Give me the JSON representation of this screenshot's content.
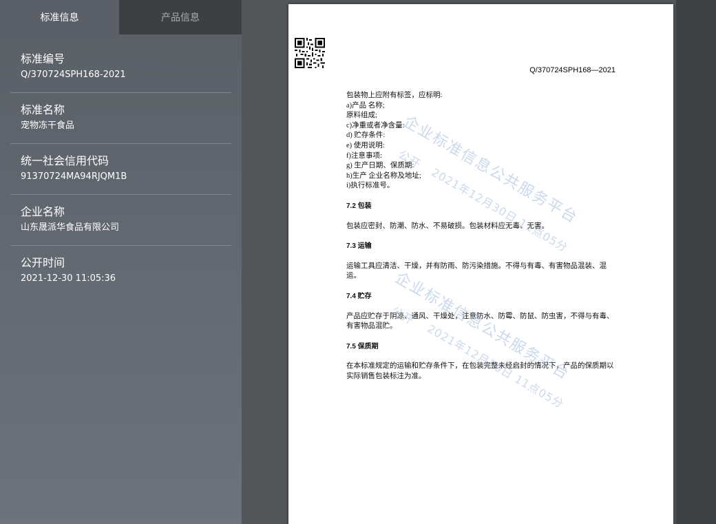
{
  "tabs": [
    {
      "label": "标准信息",
      "active": true
    },
    {
      "label": "产品信息",
      "active": false
    }
  ],
  "info": [
    {
      "label": "标准编号",
      "value": "Q/370724SPH168-2021"
    },
    {
      "label": "标准名称",
      "value": "宠物冻干食品"
    },
    {
      "label": "统一社会信用代码",
      "value": "91370724MA94RJQM1B"
    },
    {
      "label": "企业名称",
      "value": "山东晟派华食品有限公司"
    },
    {
      "label": "公开时间",
      "value": "2021-12-30 11:05:36"
    }
  ],
  "document": {
    "standard_number": "Q/370724SPH168—2021",
    "label_intro": "包装物上应附有标签，应标明:",
    "label_items": [
      "a)产品  名称;",
      "原料组成;",
      "c)净重或者净含量:",
      "d)  贮存条件:",
      "e)  使用说明:",
      "f)注意事项:",
      "g)  生产日期、保质期:",
      "h)生产  企业名称及地址;",
      "i)执行标准号。"
    ],
    "sections": [
      {
        "heading": "7.2  包装",
        "text": "包装应密封、防潮、防水、不易破损。包装材料应无毒、无害。"
      },
      {
        "heading": "7.3  运输",
        "text": "运输工具应清洁、干燥，并有防雨、防污染措施。不得与有毒、有害物品混装、混运。"
      },
      {
        "heading": "7.4 贮存",
        "text": "产品应贮存于阴凉、通风、干燥处，注意防水、防霉、防鼠、防虫害，不得与有毒、有害物品混贮。"
      },
      {
        "heading": "7.5 保质期",
        "text": "在本标准规定的运输和贮存条件下，在包装完整未经启封的情况下，产品的保质期以实际销售包装标注为准。"
      }
    ],
    "watermark": {
      "main": "企业标准信息公共服务平台",
      "sub_public": "公开",
      "sub_time": "2021年12月30日  11点05分"
    }
  }
}
